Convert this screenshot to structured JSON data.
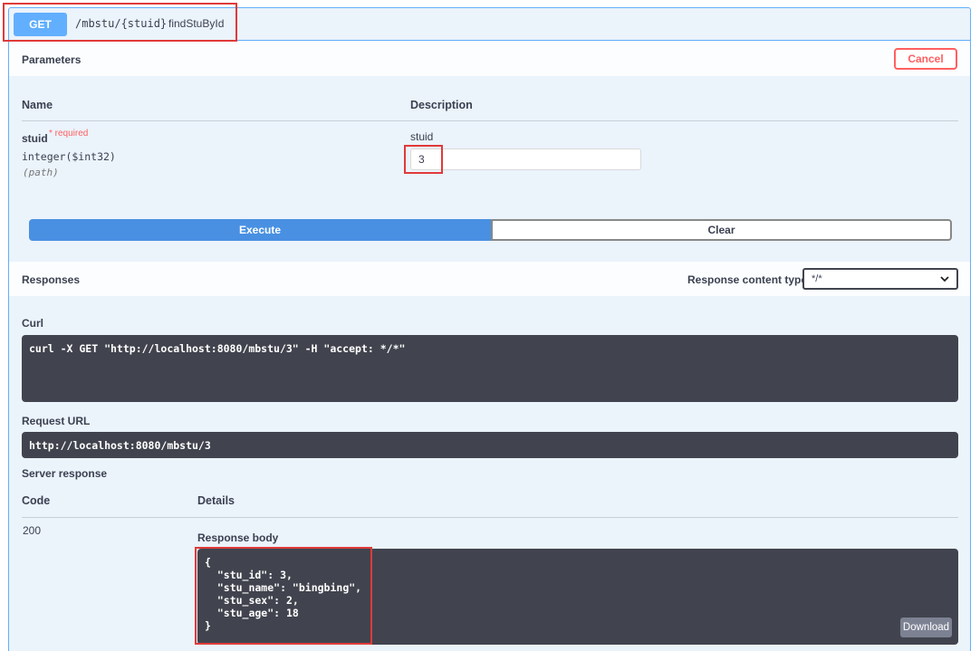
{
  "operation": {
    "method": "GET",
    "path": "/mbstu/{stuid}",
    "summary": "findStuById"
  },
  "parameters": {
    "title": "Parameters",
    "cancel_label": "Cancel",
    "col_name": "Name",
    "col_description": "Description",
    "param": {
      "name": "stuid",
      "required_label": "* required",
      "type": "integer($int32)",
      "in": "(path)",
      "description": "stuid",
      "value": "3"
    },
    "execute_label": "Execute",
    "clear_label": "Clear"
  },
  "responses": {
    "title": "Responses",
    "content_type_label": "Response content type",
    "content_type_value": "*/*",
    "curl_label": "Curl",
    "curl_command": "curl -X GET \"http://localhost:8080/mbstu/3\" -H \"accept: */*\"",
    "request_url_label": "Request URL",
    "request_url": "http://localhost:8080/mbstu/3",
    "server_response_label": "Server response",
    "col_code": "Code",
    "col_details": "Details",
    "code": "200",
    "body_label": "Response body",
    "body_lines": [
      "{",
      "  \"stu_id\": 3,",
      "  \"stu_name\": \"bingbing\",",
      "  \"stu_sex\": 2,",
      "  \"stu_age\": 18",
      "}"
    ],
    "download_label": "Download"
  },
  "colors": {
    "get_blue": "#61affe",
    "execute_blue": "#4990e2",
    "cancel_red": "#ff6060",
    "code_bg": "#41444e",
    "highlight_red": "#e03a3a"
  }
}
